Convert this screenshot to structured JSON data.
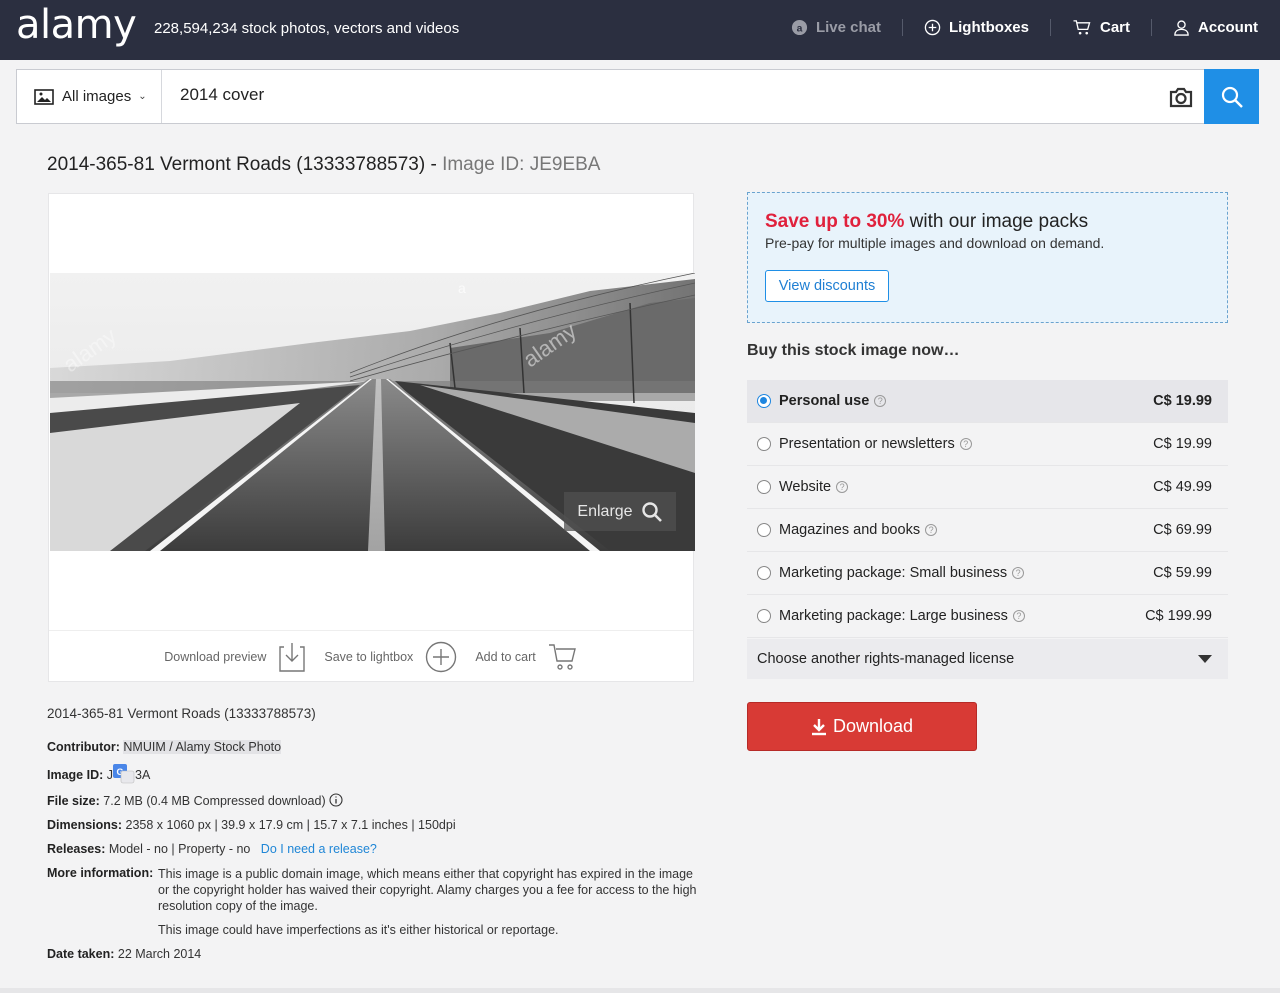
{
  "header": {
    "logo": "alamy",
    "tagline": "228,594,234 stock photos, vectors and videos",
    "nav": [
      {
        "label": "Live chat",
        "icon": "chat-icon"
      },
      {
        "label": "Lightboxes",
        "icon": "plus-circle-icon"
      },
      {
        "label": "Cart",
        "icon": "cart-icon"
      },
      {
        "label": "Account",
        "icon": "user-icon"
      }
    ]
  },
  "search": {
    "scope": "All images",
    "query": "2014 cover"
  },
  "page": {
    "title": "2014-365-81 Vermont Roads (13333788573) -",
    "image_id_label": "Image ID: JE9EBA"
  },
  "image_panel": {
    "enlarge": "Enlarge",
    "actions": {
      "download_preview": "Download preview",
      "save_to_lightbox": "Save to lightbox",
      "add_to_cart": "Add to cart"
    }
  },
  "details": {
    "title": "2014-365-81 Vermont Roads (13333788573)",
    "contributor_label": "Contributor:",
    "contributor": "NMUIM / Alamy Stock Photo",
    "image_id_label": "Image ID:",
    "image_id_start": "J",
    "image_id_end": "3A",
    "file_size_label": "File size:",
    "file_size": "7.2 MB (0.4 MB Compressed download)",
    "dimensions_label": "Dimensions:",
    "dimensions": "2358 x 1060 px | 39.9 x 17.9 cm | 15.7 x 7.1 inches | 150dpi",
    "releases_label": "Releases:",
    "releases": "Model - no | Property - no",
    "release_link": "Do I need a release?",
    "more_info_label": "More information:",
    "more_info_1": "This image is a public domain image, which means either that copyright has expired in the image or the copyright holder has waived their copyright. Alamy charges you a fee for access to the high resolution copy of the image.",
    "more_info_2": "This image could have imperfections as it's either historical or reportage.",
    "date_label": "Date taken:",
    "date": "22 March 2014"
  },
  "promo": {
    "highlight": "Save up to 30%",
    "headline_rest": " with our image packs",
    "sub": "Pre-pay for multiple images and download on demand.",
    "button": "View discounts"
  },
  "buy": {
    "heading": "Buy this stock image now…",
    "licenses": [
      {
        "label": "Personal use",
        "price": "C$ 19.99",
        "selected": true
      },
      {
        "label": "Presentation or newsletters",
        "price": "C$ 19.99",
        "selected": false
      },
      {
        "label": "Website",
        "price": "C$ 49.99",
        "selected": false
      },
      {
        "label": "Magazines and books",
        "price": "C$ 69.99",
        "selected": false
      },
      {
        "label": "Marketing package: Small business",
        "price": "C$ 59.99",
        "selected": false
      },
      {
        "label": "Marketing package: Large business",
        "price": "C$ 199.99",
        "selected": false
      }
    ],
    "other_license": "Choose another rights-managed license",
    "download": "Download"
  },
  "colors": {
    "header_bg": "#2b2f40",
    "accent_blue": "#1f8fe6",
    "promo_red": "#e0213c",
    "download_red": "#d83a35"
  }
}
